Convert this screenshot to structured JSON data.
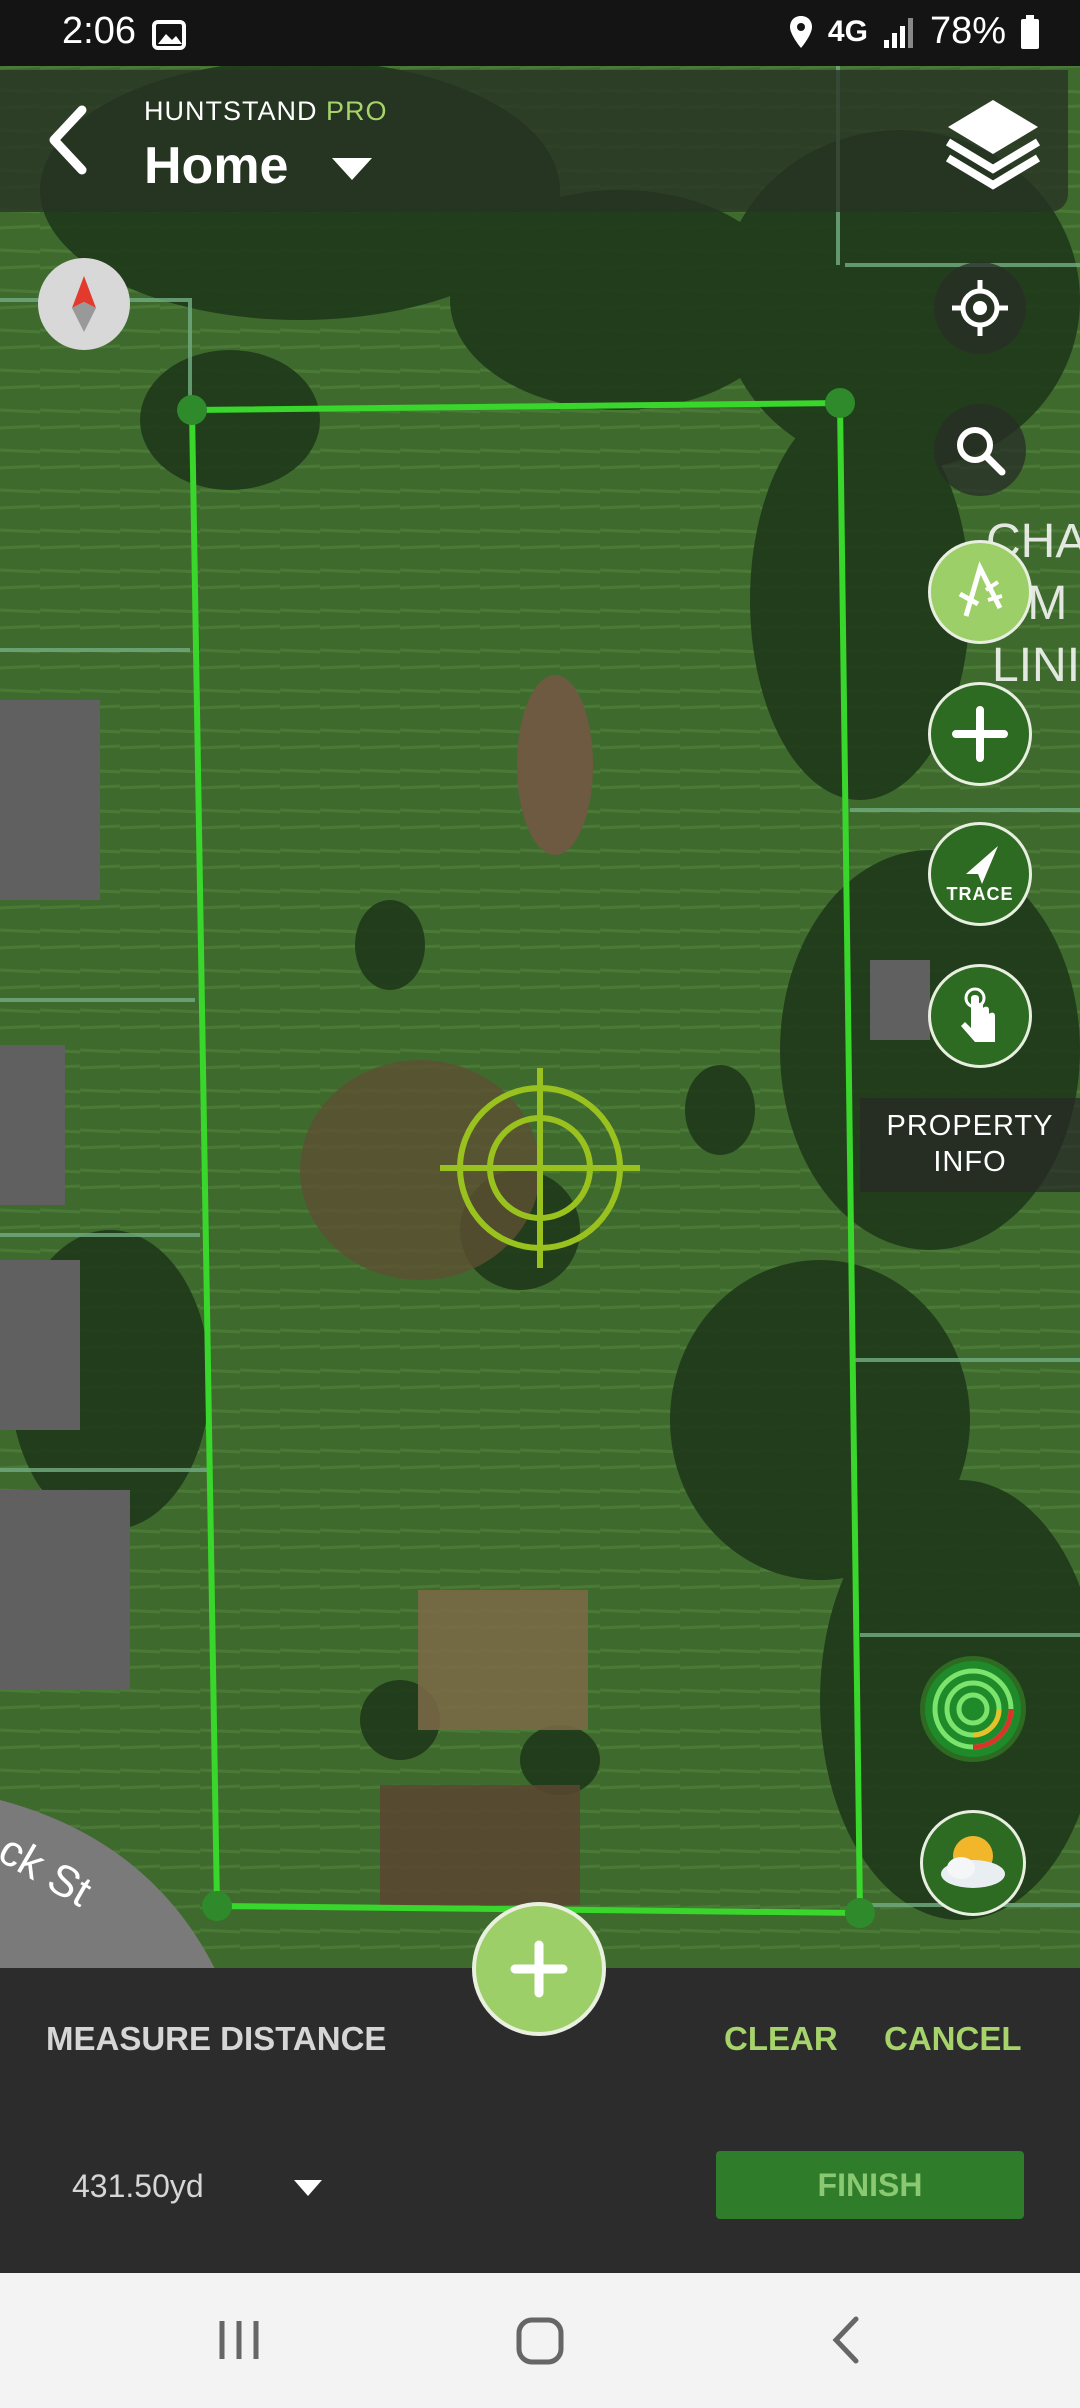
{
  "status_bar": {
    "time": "2:06",
    "network": "4G",
    "battery": "78%"
  },
  "header": {
    "brand": "HUNTSTAND",
    "brand_tier": "PRO",
    "title": "Home"
  },
  "map_labels": {
    "street": "ck St",
    "overlay_lines": [
      "CHA",
      "r M",
      "LINI"
    ]
  },
  "tools": {
    "trace_label": "TRACE",
    "property_info_line1": "PROPERTY",
    "property_info_line2": "INFO"
  },
  "measure_panel": {
    "label": "MEASURE DISTANCE",
    "clear_label": "CLEAR",
    "cancel_label": "CANCEL",
    "distance": "431.50yd",
    "finish_label": "FINISH"
  },
  "colors": {
    "accent": "#a6d46b",
    "boundary": "#39d62c",
    "finish_bg": "#2f7c2a",
    "panel_bg": "#2c2c2c"
  },
  "icons": [
    "photo-icon",
    "location-pin-icon",
    "signal-icon",
    "battery-icon",
    "back-icon",
    "caret-down-icon",
    "layers-icon",
    "compass-icon",
    "locate-icon",
    "search-icon",
    "measure-icon",
    "add-icon",
    "trace-icon",
    "touch-icon",
    "radar-icon",
    "weather-icon",
    "crosshair-icon"
  ]
}
